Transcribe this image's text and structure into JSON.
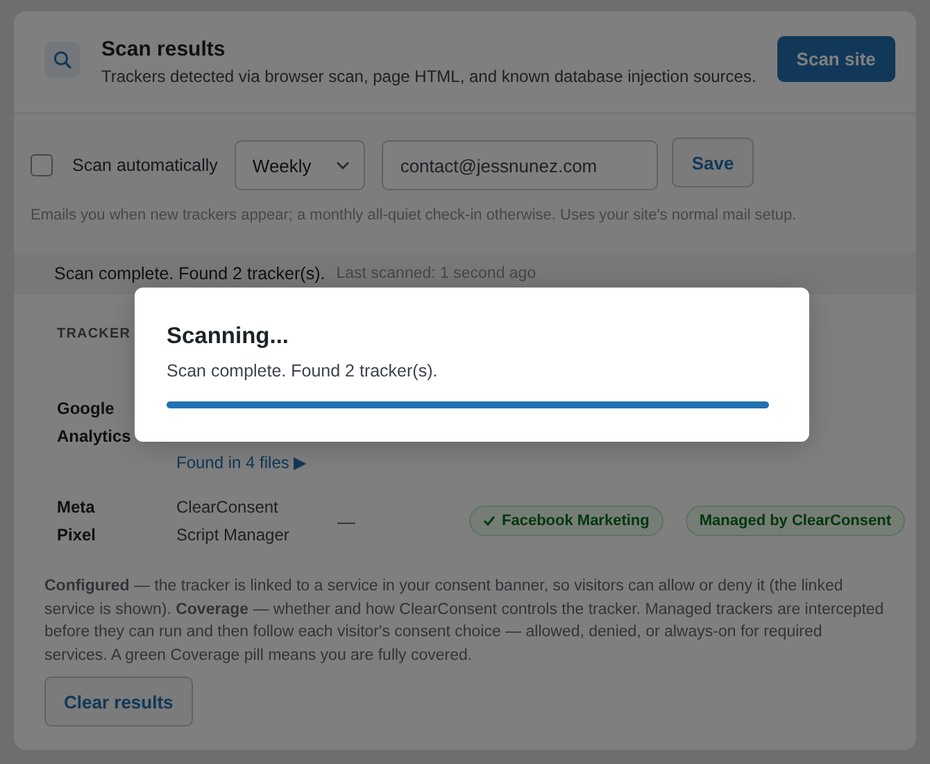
{
  "header": {
    "title": "Scan results",
    "subtitle": "Trackers detected via browser scan, page HTML, and known database injection sources.",
    "scan_button": "Scan site"
  },
  "schedule": {
    "auto_scan": {
      "label": "Scan automatically",
      "checked": false
    },
    "frequency": "Weekly",
    "email": "contact@jessnunez.com",
    "save_button": "Save",
    "hint": "Emails you when new trackers appear; a monthly all-quiet check-in otherwise. Uses your site's normal mail setup."
  },
  "status": {
    "message": "Scan complete. Found 2 tracker(s).",
    "last_scanned": "Last scanned: 1 second ago"
  },
  "table": {
    "column_1": "TRACKER",
    "rows": [
      {
        "tracker": "Google Analytics",
        "files_link": "Found in 4 files ▶"
      },
      {
        "tracker": "Meta Pixel",
        "source": "ClearConsent Script Manager",
        "column_3": "—",
        "configured": {
          "label": "Facebook Marketing",
          "checked": true
        },
        "coverage": "Managed by ClearConsent"
      }
    ]
  },
  "notes": "**Configured** — the tracker is linked to a service in your consent banner, so visitors can allow or deny it (the linked service is shown). **Coverage** — whether and how ClearConsent controls the tracker. Managed trackers are intercepted before they can run and then follow each visitor's consent choice — allowed, denied, or always-on for required services. A green Coverage pill means you are fully covered.",
  "clear_button": "Clear results",
  "modal": {
    "title": "Scanning...",
    "message": "Scan complete. Found 2 tracker(s).",
    "level": 1
  }
}
